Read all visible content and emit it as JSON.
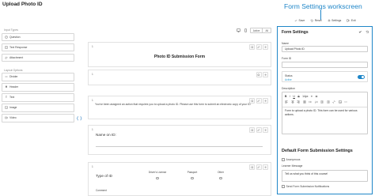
{
  "page": {
    "title": "Upload Photo ID"
  },
  "annotation": {
    "label": "Form Settings workscreen",
    "color": "#1f86c8"
  },
  "toolbar": {
    "save": "Save",
    "reset": "Reset",
    "settings": "Settings",
    "exit": "Exit"
  },
  "sidebar": {
    "input_types_label": "Input Types",
    "input_types": [
      {
        "label": "Question",
        "icon": "question-icon"
      },
      {
        "label": "Text Response",
        "icon": "text-response-icon"
      },
      {
        "label": "Attachment",
        "icon": "attachment-icon"
      }
    ],
    "layout_label": "Layout Options",
    "layout_options": [
      {
        "label": "Divider",
        "icon": "divider-icon"
      },
      {
        "label": "Header",
        "icon": "header-icon"
      },
      {
        "label": "Text",
        "icon": "text-icon"
      },
      {
        "label": "Image",
        "icon": "image-icon"
      },
      {
        "label": "Video",
        "icon": "video-icon"
      }
    ]
  },
  "canvas": {
    "view_toggle": {
      "active": "Active",
      "all": "All"
    },
    "blocks": [
      {
        "number": "1",
        "text": "Photo ID Submission Form"
      },
      {
        "number": "1"
      },
      {
        "number": "1",
        "text": "You've been assigned an action that requires you to upload a photo ID. Please use this form to submit an electronic copy of your ID."
      },
      {
        "number": "1",
        "label": "Name on ID:"
      },
      {
        "number": "1",
        "label": "Type of ID",
        "options": [
          "Driver's License",
          "Passport",
          "Other"
        ],
        "comment_label": "Comment"
      }
    ]
  },
  "settings_panel": {
    "heading": "Form Settings",
    "name_label": "Name",
    "name_value": "Upload Photo ID",
    "form_id_label": "Form ID",
    "form_id_value": "",
    "status_label": "Status",
    "status_value": "Active",
    "status_on": true,
    "description_label": "Description",
    "editor_row1": [
      "B",
      "I",
      "U",
      "S",
      "14px",
      "≡"
    ],
    "description_text": "Form to upload a photo ID. This form can be used for various actions.",
    "default_heading": "Default Form Submission Settings",
    "anonymous_label": "Anonymous",
    "learner_message_label": "Learner Message",
    "learner_message_value": "Tell us what you think of this course!",
    "send_notifications_label": "Send Form Submission Notifications"
  }
}
